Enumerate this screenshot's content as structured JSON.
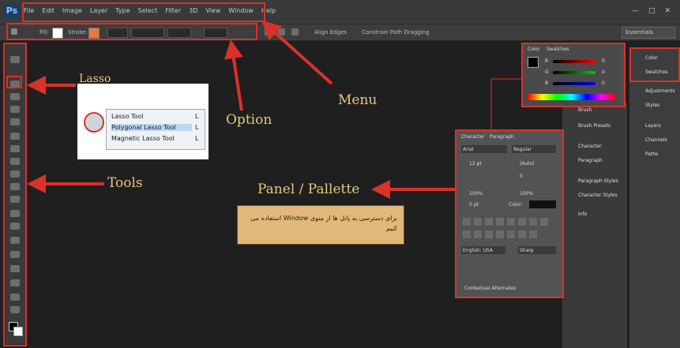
{
  "app": {
    "logo": "Ps"
  },
  "menubar": {
    "items": [
      "File",
      "Edit",
      "Image",
      "Layer",
      "Type",
      "Select",
      "Filter",
      "3D",
      "View",
      "Window",
      "Help"
    ],
    "window_controls": [
      "—",
      "□",
      "✕"
    ]
  },
  "options_bar": {
    "fill_label": "Fill:",
    "stroke_label": "Stroke:",
    "align_edges": "Align Edges",
    "constrain": "Constrain Path Dragging",
    "workspace": "Essentials"
  },
  "annotations": {
    "lasso": "Lasso",
    "option": "Option",
    "menu": "Menu",
    "tools": "Tools",
    "panel": "Panel / Pallette"
  },
  "lasso_menu": {
    "items": [
      "Lasso Tool",
      "Polygonal Lasso Tool",
      "Magnetic Lasso Tool"
    ],
    "shortcuts": [
      "L",
      "L",
      "L"
    ]
  },
  "note": {
    "text": "برای دسترسی به پانل ها از منوی Window استفاده می کنیم"
  },
  "color_panel": {
    "tabs": [
      "Color",
      "Swatches"
    ],
    "channels": [
      {
        "label": "R",
        "value": "0"
      },
      {
        "label": "G",
        "value": "0"
      },
      {
        "label": "B",
        "value": "0"
      }
    ]
  },
  "character_panel": {
    "tabs": [
      "Character",
      "Paragraph"
    ],
    "font": "Arial",
    "style": "Regular",
    "size": "12 pt",
    "leading": "(Auto)",
    "tracking": "0",
    "scale_v": "100%",
    "scale_h": "100%",
    "baseline": "0 pt",
    "color_label": "Color:",
    "language": "English: USA",
    "aa": "Sharp",
    "footer": "Contextual Alternates"
  },
  "side_panels": {
    "middle": [
      "Brush",
      "Brush Presets",
      "Character",
      "Paragraph",
      "Paragraph Styles",
      "Character Styles",
      "Info"
    ],
    "right": [
      "Color",
      "Swatches",
      "Adjustments",
      "Styles",
      "Layers",
      "Channels",
      "Paths"
    ]
  }
}
